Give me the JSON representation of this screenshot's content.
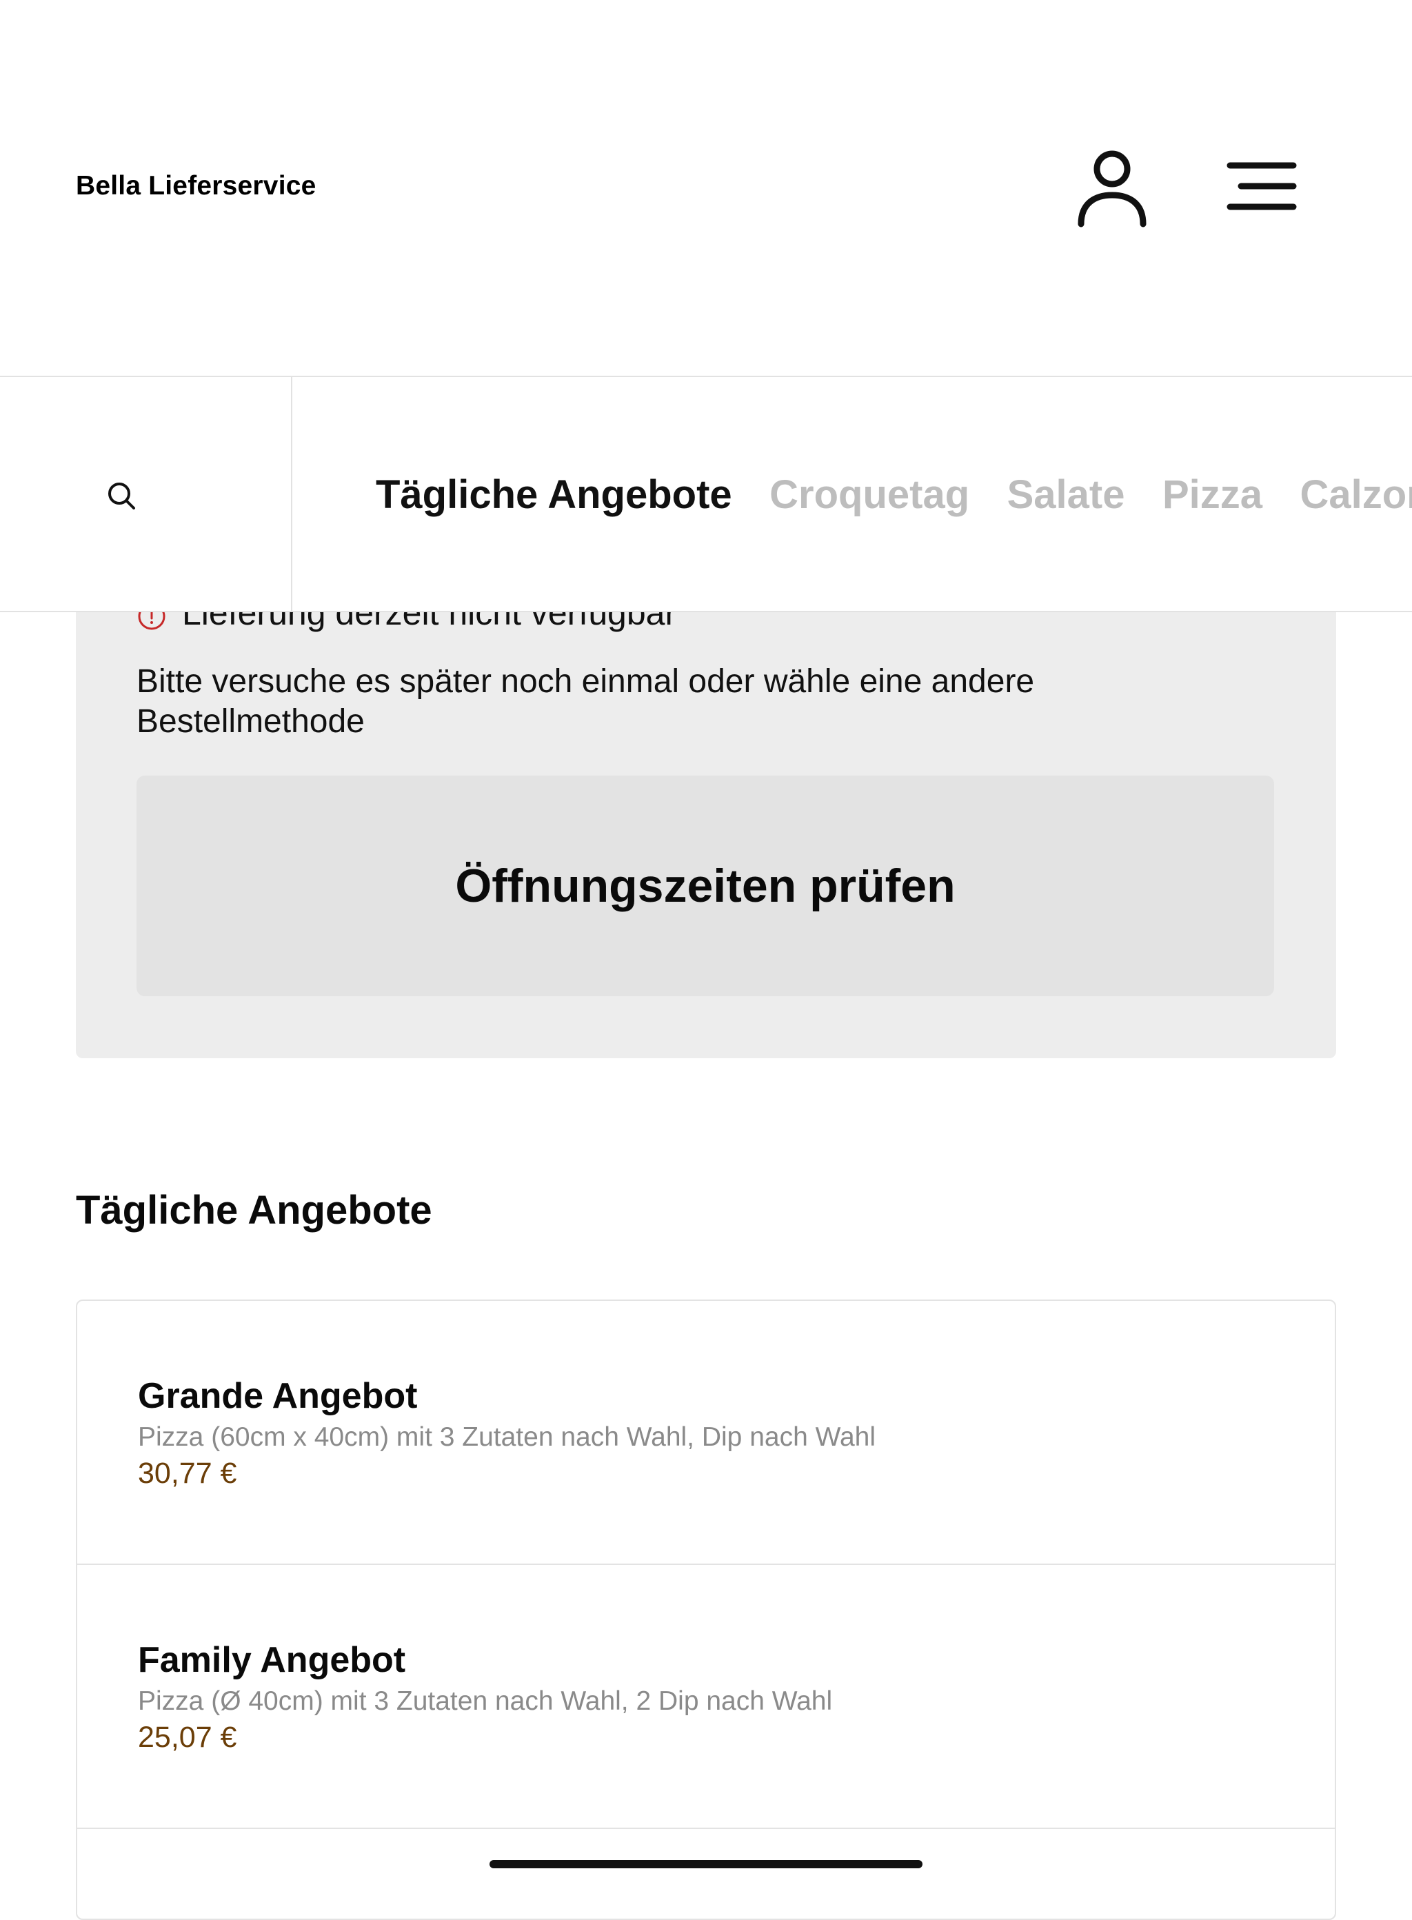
{
  "header": {
    "brand": "Bella Lieferservice",
    "icons": [
      "user-icon",
      "menu-icon"
    ]
  },
  "nav": {
    "search_icon": "search-icon",
    "tabs": [
      {
        "label": "Tägliche Angebote",
        "active": true
      },
      {
        "label": "Croquetag",
        "active": false
      },
      {
        "label": "Salate",
        "active": false
      },
      {
        "label": "Pizza",
        "active": false
      },
      {
        "label": "Calzone",
        "active": false
      }
    ]
  },
  "notice": {
    "title": "Lieferung derzeit nicht verfügbar",
    "body": "Bitte versuche es später noch einmal oder wähle eine andere Bestellmethode",
    "button_label": "Öffnungszeiten prüfen",
    "alert_color": "#c62828"
  },
  "section": {
    "title": "Tägliche Angebote"
  },
  "items": [
    {
      "name": "Grande Angebot",
      "description": "Pizza (60cm x 40cm) mit 3 Zutaten nach Wahl, Dip nach Wahl",
      "price": "30,77 €"
    },
    {
      "name": "Family Angebot",
      "description": "Pizza (Ø 40cm) mit 3 Zutaten nach Wahl, 2 Dip nach Wahl",
      "price": "25,07 €"
    }
  ],
  "colors": {
    "price": "#6b3e08",
    "inactive_tab": "#bdbdbd",
    "panel": "#ededed"
  }
}
